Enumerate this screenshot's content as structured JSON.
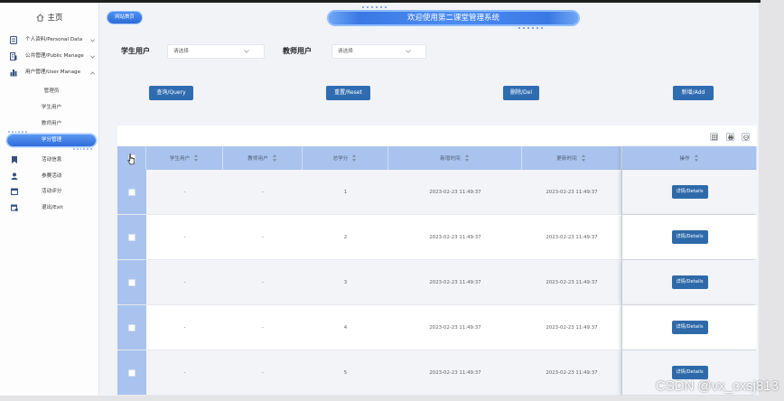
{
  "sidebar": {
    "home": {
      "label": "主页",
      "icon": "home-icon"
    },
    "menu": [
      {
        "label": "个人资料/Personal Data",
        "icon": "id-card-icon",
        "expanded": false
      },
      {
        "label": "公共管理/Public Manage",
        "icon": "building-icon",
        "expanded": false
      },
      {
        "label": "用户管理/User Manage",
        "icon": "users-icon",
        "expanded": true,
        "children": [
          {
            "label": "管理员",
            "active": false
          },
          {
            "label": "学生用户",
            "active": false
          },
          {
            "label": "教师用户",
            "active": false
          },
          {
            "label": "学分管理",
            "active": true
          }
        ]
      }
    ],
    "items": [
      {
        "label": "活动信息",
        "icon": "bookmark-icon"
      },
      {
        "label": "参赛活动",
        "icon": "person-icon"
      },
      {
        "label": "活动评分",
        "icon": "calendar-icon"
      },
      {
        "label": "退出/Exit",
        "icon": "exit-icon"
      }
    ]
  },
  "header": {
    "home_button": "网站首页",
    "title": "欢迎使用第二课堂管理系统"
  },
  "filters": {
    "student": {
      "label": "学生用户",
      "placeholder": "请选择"
    },
    "teacher": {
      "label": "教师用户",
      "placeholder": "请选择"
    }
  },
  "actions": {
    "query": "查询/Query",
    "reset": "重置/Reset",
    "delete": "删除/Del",
    "add": "新增/Add"
  },
  "table": {
    "toolbar_icons": [
      "columns-icon",
      "print-icon",
      "export-icon"
    ],
    "columns": [
      "学生用户",
      "教师用户",
      "总学分",
      "新增时间",
      "更新时间",
      "操作"
    ],
    "action_label": "详情/Details",
    "rows": [
      {
        "student": "-",
        "teacher": "-",
        "credits": 1,
        "created": "2023-02-23 11:49:37",
        "updated": "2023-02-23 11:49:37"
      },
      {
        "student": "-",
        "teacher": "-",
        "credits": 2,
        "created": "2023-02-23 11:49:37",
        "updated": "2023-02-23 11:49:37"
      },
      {
        "student": "-",
        "teacher": "-",
        "credits": 3,
        "created": "2023-02-23 11:49:37",
        "updated": "2023-02-23 11:49:37"
      },
      {
        "student": "-",
        "teacher": "-",
        "credits": 4,
        "created": "2023-02-23 11:49:37",
        "updated": "2023-02-23 11:49:37"
      },
      {
        "student": "-",
        "teacher": "-",
        "credits": 5,
        "created": "2023-02-23 11:49:37",
        "updated": "2023-02-23 11:49:37"
      }
    ]
  },
  "watermark": "CSDN @vx_cxsj813",
  "colors": {
    "primary_button": "#2f6cb0",
    "table_header": "#a9c3ee",
    "banner": "#3e7fe6",
    "sidebar_icon": "#33507f",
    "page_background": "#f1f3f7"
  }
}
